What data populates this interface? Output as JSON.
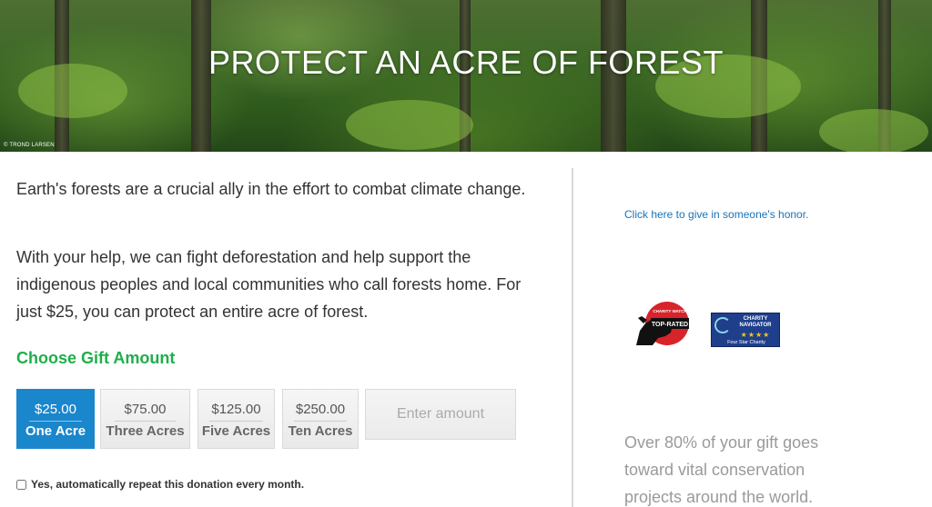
{
  "hero": {
    "title": "PROTECT AN ACRE OF FOREST",
    "credit": "© TROND LARSEN"
  },
  "intro": {
    "paragraph_1": "Earth's forests are a crucial ally in the effort to combat climate change.",
    "paragraph_2": "With your help, we can fight deforestation and help support the indigenous peoples and local communities who call forests home. For just $25, you can protect an entire acre of forest."
  },
  "gift": {
    "title": "Choose Gift Amount",
    "options": [
      {
        "amount": "$25.00",
        "label": "One Acre",
        "selected": true
      },
      {
        "amount": "$75.00",
        "label": "Three Acres",
        "selected": false
      },
      {
        "amount": "$125.00",
        "label": "Five Acres",
        "selected": false
      },
      {
        "amount": "$250.00",
        "label": "Ten Acres",
        "selected": false
      }
    ],
    "custom_placeholder": "Enter amount",
    "repeat_label": "Yes, automatically repeat this donation every month."
  },
  "sidebar": {
    "honor_link": "Click here to give in someone's honor.",
    "badges": {
      "charity_watch_top": "CHARITY WATCH",
      "charity_watch_main": "TOP-RATED",
      "charity_navigator_title": "CHARITY NAVIGATOR",
      "charity_navigator_stars": "★★★★",
      "charity_navigator_sub": "Four Star Charity"
    },
    "gift_note": "Over 80% of your gift goes toward vital conservation projects around the world."
  },
  "colors": {
    "accent_green": "#1fae4b",
    "selected_blue": "#1a86cc",
    "link_blue": "#1a73b9"
  }
}
